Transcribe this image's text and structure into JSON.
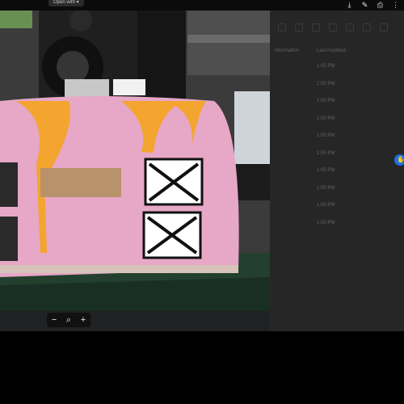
{
  "toolbar": {
    "open_with_label": "Open with ▾",
    "icons": [
      "download-icon",
      "comment-icon",
      "print-icon",
      "more-icon"
    ]
  },
  "side_panel": {
    "header_col1": "Information",
    "header_col2": "Last modified",
    "rows": [
      "1:05 PM",
      "1:05 PM",
      "1:05 PM",
      "1:05 PM",
      "1:05 PM",
      "1:05 PM",
      "1:05 PM",
      "1:05 PM",
      "1:05 PM",
      "1:05 PM"
    ]
  },
  "zoom": {
    "minus": "−",
    "magnifier": "⌕",
    "plus": "+"
  },
  "fab": {
    "glyph": "✋"
  }
}
